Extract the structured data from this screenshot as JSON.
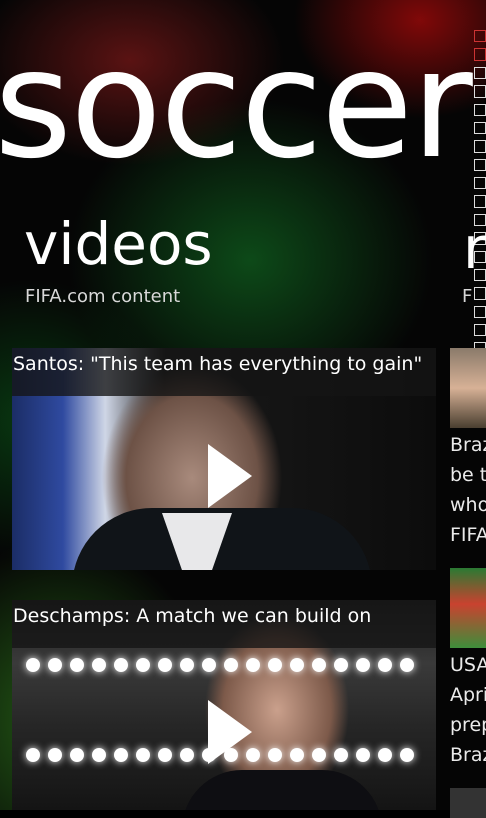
{
  "app": {
    "title": "soccer"
  },
  "section": {
    "title": "videos",
    "subtitle": "FIFA.com content"
  },
  "next_section": {
    "title_peek": "r",
    "subtitle_peek": "F"
  },
  "videos": [
    {
      "caption": "Santos: \"This team has everything to gain\""
    },
    {
      "caption": "Deschamps: A match we can build on"
    }
  ],
  "news_peek": [
    {
      "lines": [
        "Braz",
        "be th",
        "who",
        "FIFA"
      ]
    },
    {
      "lines": [
        "USA",
        "Apri",
        "prep",
        "Braz"
      ]
    }
  ],
  "colors": {
    "background": "#000000",
    "text": "#ffffff",
    "subtext": "#d8d8d8"
  },
  "icons": {
    "play": "play-icon"
  }
}
